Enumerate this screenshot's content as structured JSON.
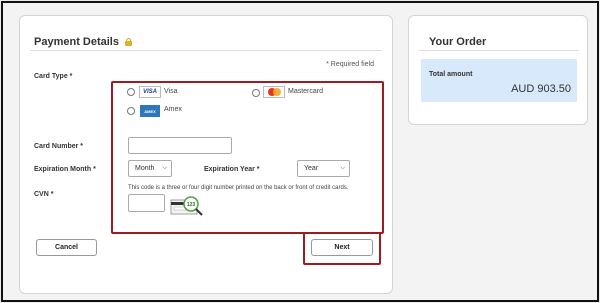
{
  "payment": {
    "title": "Payment Details",
    "lock_icon": "lock-icon",
    "required_note": "* Required field",
    "card_type_label": "Card Type *",
    "card_types": [
      {
        "name": "Visa",
        "logo_text": "VISA",
        "icon": "visa-logo-icon"
      },
      {
        "name": "Mastercard",
        "logo_text": "",
        "icon": "mastercard-logo-icon"
      },
      {
        "name": "Amex",
        "logo_text": "AMEX",
        "icon": "amex-logo-icon"
      }
    ],
    "card_number_label": "Card Number *",
    "card_number_value": "",
    "expiration_month_label": "Expiration Month *",
    "expiration_month_value": "Month",
    "expiration_year_label": "Expiration Year *",
    "expiration_year_value": "Year",
    "cvn_label": "CVN *",
    "cvn_hint": "This code is a three or four digit number printed on the back or front of credit cards.",
    "cvn_value": "",
    "cvn_image_text": "123",
    "cancel_label": "Cancel",
    "next_label": "Next"
  },
  "order": {
    "title": "Your Order",
    "total_label": "Total amount",
    "total_amount": "AUD 903.50"
  },
  "colors": {
    "highlight": "#9e1b22",
    "total_bg": "#d7e9fb"
  }
}
